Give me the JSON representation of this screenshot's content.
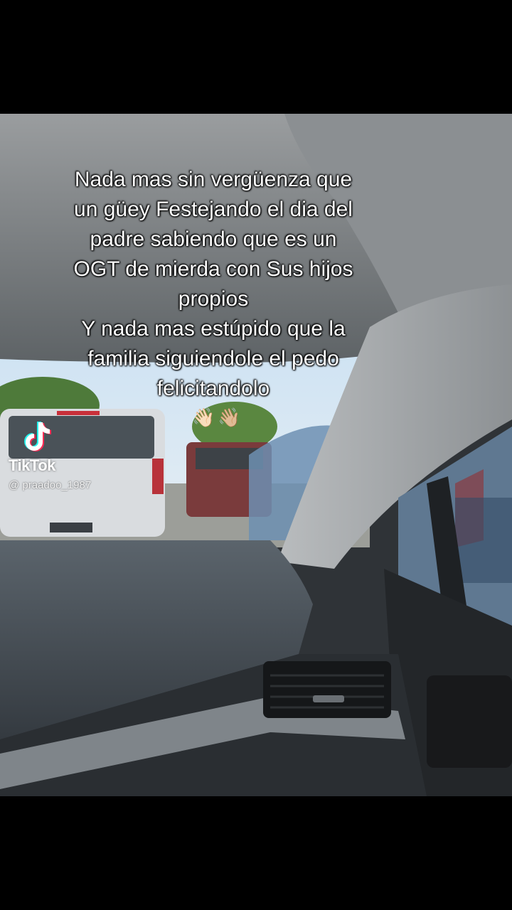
{
  "caption": {
    "text": "Nada mas sin vergüenza que\nun güey Festejando el dia del\npadre sabiendo que es un\nOGT de mierda con Sus hijos\npropios\nY nada mas estúpido que la\nfamilia siguiendole el pedo\nfelicitandolo"
  },
  "emoji": [
    "👋🏻",
    "👋🏼"
  ],
  "watermark": {
    "brand": "TikTok",
    "handle": "@ praadoo_1987"
  },
  "colors": {
    "letterbox": "#000000",
    "dashboard": "#2f3337",
    "tiktok_cyan": "#25F4EE",
    "tiktok_red": "#FE2C55"
  }
}
